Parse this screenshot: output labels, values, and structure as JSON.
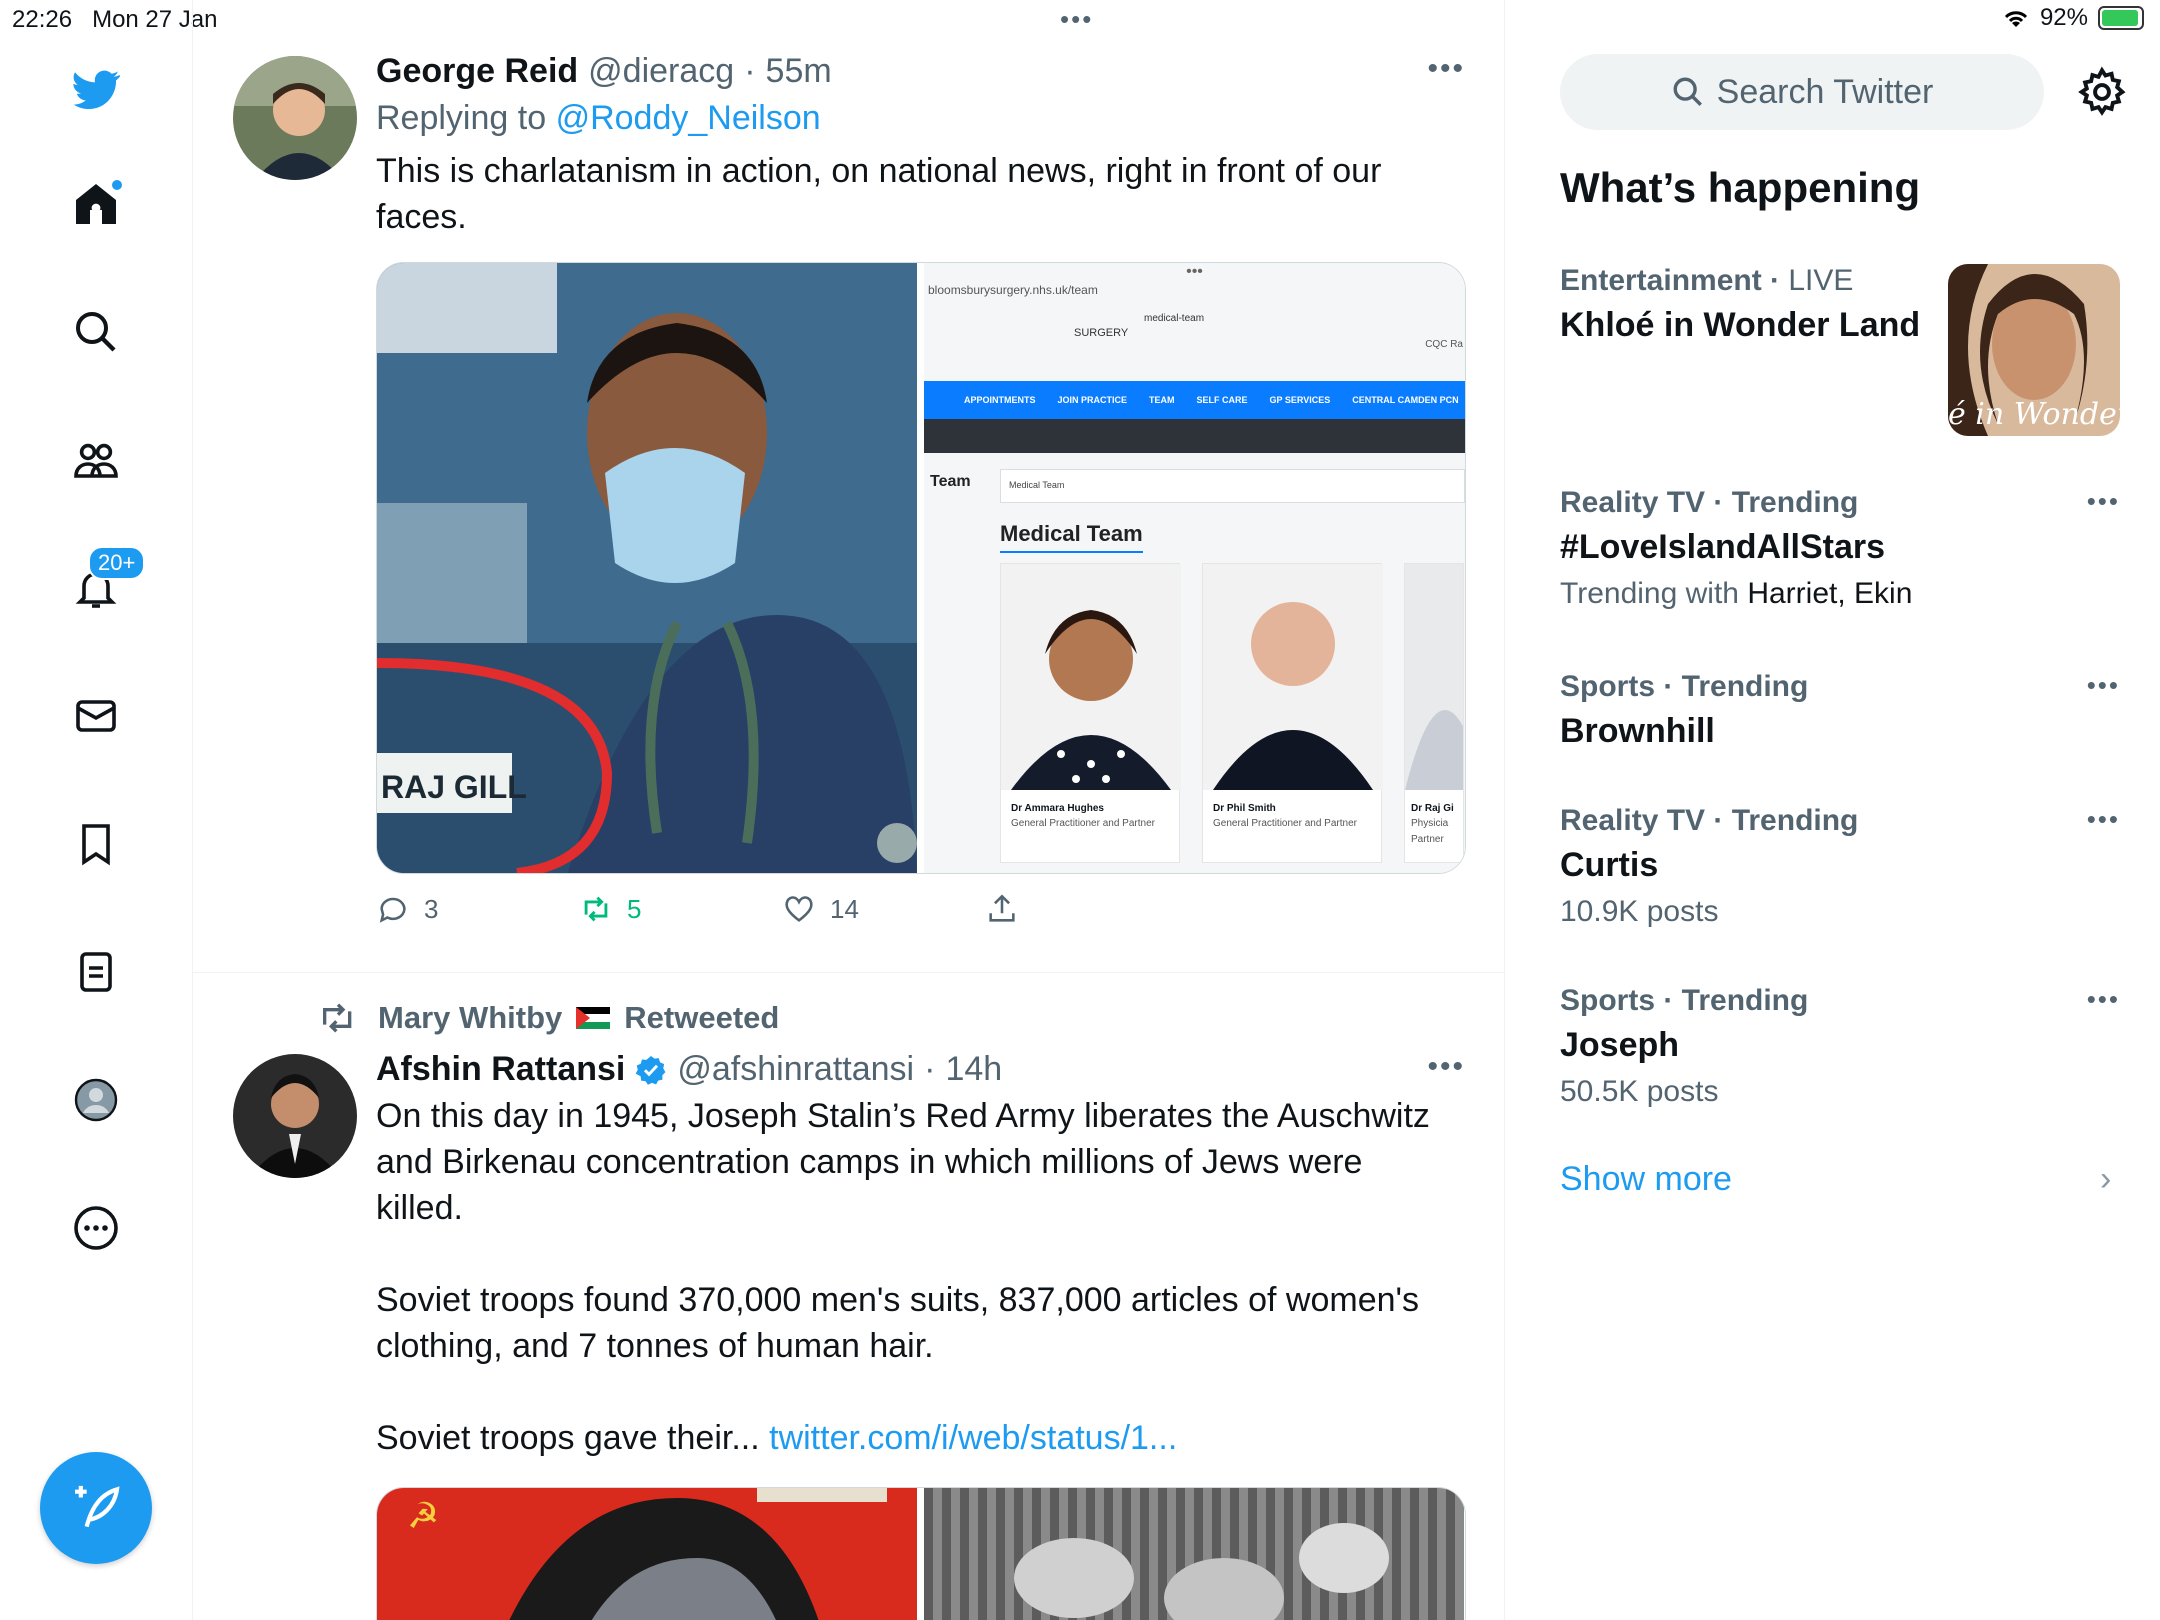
{
  "status_bar": {
    "time": "22:26",
    "date": "Mon 27 Jan",
    "battery": "92%"
  },
  "nav": {
    "notifications_badge": "20+"
  },
  "tweets": [
    {
      "name": "George Reid",
      "handle": "@dieracg",
      "time": "55m",
      "replying_to_label": "Replying to",
      "replying_to": "@Roddy_Neilson",
      "text": "This is charlatanism in action, on national news, right in front of our faces.",
      "media_caption": "RAJ GILL",
      "media_web": {
        "url": "bloomsburysurgery.nhs.uk/team",
        "tab": "medical-team",
        "surgery": "SURGERY",
        "cqc": "CQC Ra",
        "menu": [
          "APPOINTMENTS",
          "JOIN PRACTICE",
          "TEAM",
          "SELF CARE",
          "GP SERVICES",
          "CENTRAL CAMDEN PCN"
        ],
        "team_label": "Team",
        "breadcrumb": "Medical Team",
        "heading": "Medical Team",
        "doctors": [
          {
            "name": "Dr Ammara Hughes",
            "role": "General Practitioner and Partner"
          },
          {
            "name": "Dr Phil Smith",
            "role": "General Practitioner and Partner"
          },
          {
            "name": "Dr Raj Gi",
            "role": "Physicia Partner"
          }
        ]
      },
      "replies": "3",
      "retweets": "5",
      "likes": "14"
    },
    {
      "retweeted_by": "Mary Whitby",
      "retweeted_label": "Retweeted",
      "name": "Afshin Rattansi",
      "handle": "@afshinrattansi",
      "time": "14h",
      "text_1": "On this day in 1945, Joseph Stalin’s Red Army liberates the Auschwitz and Birkenau concentration camps in which millions of Jews were killed.",
      "text_2": "Soviet troops found 370,000 men's suits, 837,000 articles of women's clothing, and 7 tonnes of human hair.",
      "text_3": "Soviet troops gave their...",
      "link": "twitter.com/i/web/status/1..."
    }
  ],
  "right": {
    "search_placeholder": "Search Twitter",
    "section_title": "What’s happening",
    "trends": [
      {
        "category": "Entertainment",
        "live": "LIVE",
        "name": "Khloé in Wonder Land",
        "image_text": "é in Wonder L"
      },
      {
        "category": "Reality TV · Trending",
        "name": "#LoveIslandAllStars",
        "sub_prefix": "Trending with",
        "sub_names": "Harriet, Ekin"
      },
      {
        "category": "Sports · Trending",
        "name": "Brownhill"
      },
      {
        "category": "Reality TV · Trending",
        "name": "Curtis",
        "sub": "10.9K posts"
      },
      {
        "category": "Sports · Trending",
        "name": "Joseph",
        "sub": "50.5K posts"
      }
    ],
    "show_more": "Show more"
  },
  "colors": {
    "accent": "#1d9bf0",
    "retweet": "#00ba7c",
    "muted": "#536471"
  }
}
